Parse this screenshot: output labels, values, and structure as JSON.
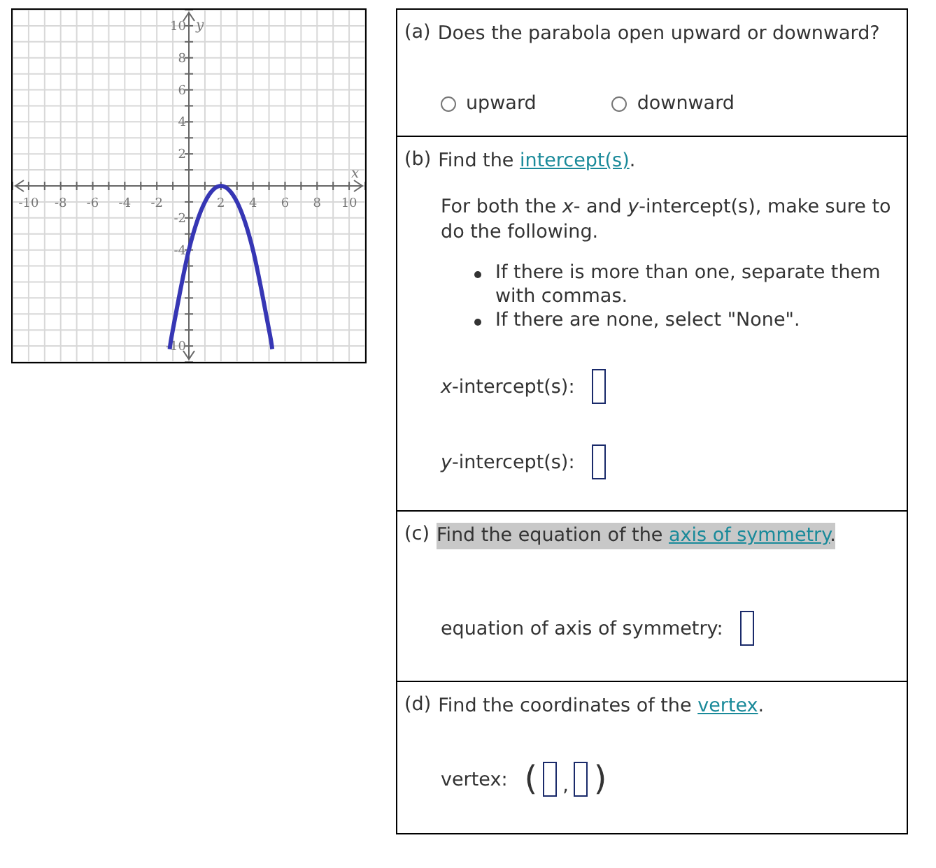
{
  "graph": {
    "chart_data": {
      "type": "line",
      "xlabel": "x",
      "ylabel": "y",
      "xlim": [
        -11,
        11
      ],
      "ylim": [
        -11,
        11
      ],
      "grid": true,
      "xticks": [
        -10,
        -8,
        -6,
        -4,
        -2,
        2,
        4,
        6,
        8,
        10
      ],
      "yticks": [
        -10,
        -4,
        -2,
        2,
        4,
        6,
        8,
        10
      ],
      "x": [
        -1.2,
        -1,
        0,
        1,
        2,
        3,
        4,
        5,
        5.2
      ],
      "series": [
        {
          "color": "#3636b4",
          "values": [
            -10.2,
            -9,
            -4,
            -1,
            0,
            -1,
            -4,
            -9,
            -10.2
          ]
        }
      ]
    }
  },
  "parts": [
    {
      "label": "(a)",
      "kind": "choice",
      "question": {
        "before": "Does the parabola open upward or downward?"
      },
      "highlighted": false,
      "options": [
        {
          "label": "upward",
          "selected": false
        },
        {
          "label": "downward",
          "selected": false
        }
      ]
    },
    {
      "label": "(b)",
      "kind": "intercepts",
      "question": {
        "before": "Find the ",
        "link": "intercept(s)",
        "after": "."
      },
      "highlighted": false,
      "instruction": "For both the *x*- and *y*-intercept(s), make sure to do the following.",
      "bullets": [
        "If there is more than one, separate them with commas.",
        "If there are none, select \"None\"."
      ],
      "fields": [
        {
          "kind": "single",
          "label": "*x*-intercept(s):"
        },
        {
          "kind": "single",
          "label": "*y*-intercept(s):"
        }
      ]
    },
    {
      "label": "(c)",
      "kind": "answer",
      "question": {
        "before": "Find the equation of the ",
        "link": "axis of symmetry",
        "after": "."
      },
      "highlighted": true,
      "fields": [
        {
          "kind": "single",
          "label": "equation of axis of symmetry:"
        }
      ]
    },
    {
      "label": "(d)",
      "kind": "answer",
      "question": {
        "before": "Find the coordinates of the ",
        "link": "vertex",
        "after": "."
      },
      "highlighted": false,
      "fields": [
        {
          "kind": "pair",
          "label": "vertex:",
          "open": "(",
          "separator": ",",
          "close": ")"
        }
      ]
    }
  ]
}
